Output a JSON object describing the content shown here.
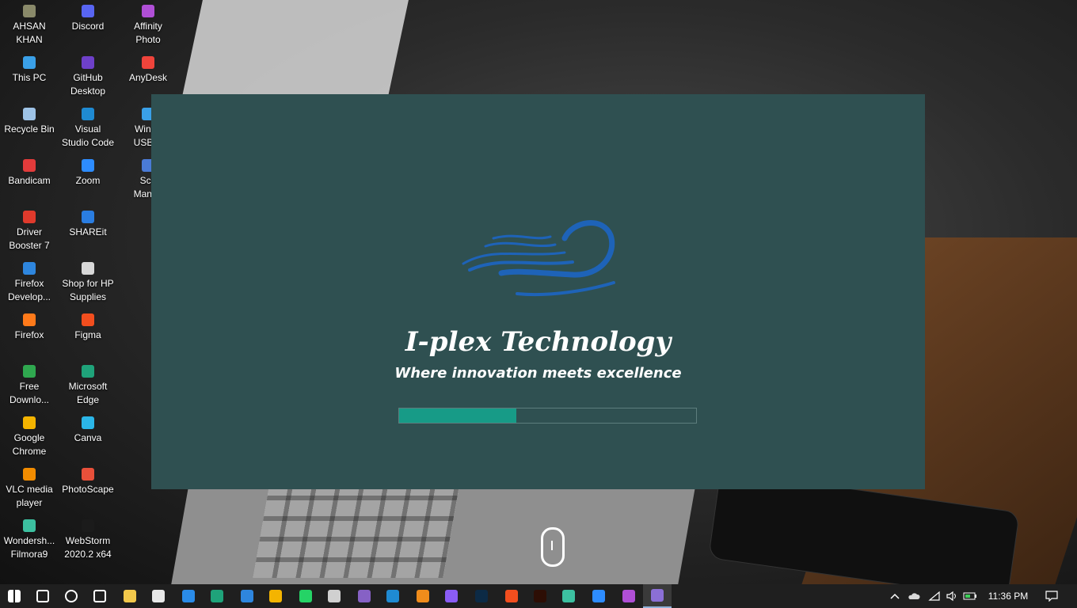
{
  "desktop": {
    "icons": [
      {
        "label": "AHSAN\nKHAN",
        "icon": "user-folder-icon",
        "color": "#8a8a6a"
      },
      {
        "label": "Discord",
        "icon": "discord-icon",
        "color": "#5865f2"
      },
      {
        "label": "Affinity\nPhoto",
        "icon": "affinity-photo-icon",
        "color": "#b04fd6"
      },
      {
        "label": "This PC",
        "icon": "this-pc-icon",
        "color": "#3aa0e8"
      },
      {
        "label": "GitHub\nDesktop",
        "icon": "github-desktop-icon",
        "color": "#6e40c9"
      },
      {
        "label": "AnyDesk",
        "icon": "anydesk-icon",
        "color": "#ef443b"
      },
      {
        "label": "Recycle Bin",
        "icon": "recycle-bin-icon",
        "color": "#9ec3e6"
      },
      {
        "label": "Visual\nStudio Code",
        "icon": "vscode-icon",
        "color": "#1f8ad2"
      },
      {
        "label": "Windo\nUSB D",
        "icon": "windows-usb-icon",
        "color": "#3aa0e8"
      },
      {
        "label": "Bandicam",
        "icon": "bandicam-icon",
        "color": "#e23b3b"
      },
      {
        "label": "Zoom",
        "icon": "zoom-icon",
        "color": "#2d8cff"
      },
      {
        "label": "Sch\nManag",
        "icon": "school-manager-icon",
        "color": "#4a7bd6"
      },
      {
        "label": "Driver\nBooster 7",
        "icon": "driver-booster-icon",
        "color": "#e03a2c"
      },
      {
        "label": "SHAREit",
        "icon": "shareit-icon",
        "color": "#2a7de1"
      },
      {
        "label": "Firefox\nDevelop...",
        "icon": "firefox-developer-icon",
        "color": "#2e86de"
      },
      {
        "label": "Shop for HP\nSupplies",
        "icon": "hp-supplies-icon",
        "color": "#d8d8d8"
      },
      {
        "label": "Firefox",
        "icon": "firefox-icon",
        "color": "#ff7a1a"
      },
      {
        "label": "Figma",
        "icon": "figma-icon",
        "color": "#f24e1e"
      },
      {
        "label": "Free\nDownlo...",
        "icon": "free-download-manager-icon",
        "color": "#2fa84f"
      },
      {
        "label": "Microsoft\nEdge",
        "icon": "edge-icon",
        "color": "#1fa37a"
      },
      {
        "label": "Google\nChrome",
        "icon": "chrome-icon",
        "color": "#f4b400"
      },
      {
        "label": "Canva",
        "icon": "canva-icon",
        "color": "#2bb6e8"
      },
      {
        "label": "VLC media\nplayer",
        "icon": "vlc-icon",
        "color": "#f28c00"
      },
      {
        "label": "PhotoScape",
        "icon": "photoscape-icon",
        "color": "#e8503a"
      },
      {
        "label": "Wondersh...\nFilmora9",
        "icon": "filmora-icon",
        "color": "#3cc0a0"
      },
      {
        "label": "WebStorm\n2020.2 x64",
        "icon": "webstorm-icon",
        "color": "#1b1b1b"
      }
    ]
  },
  "splash": {
    "brand": "I-plex Technology",
    "tagline": "Where innovation meets excellence",
    "progress_fraction": 0.395,
    "colors": {
      "background": "#2f5051",
      "progress": "#179b87",
      "logo": "#1e63b8"
    }
  },
  "taskbar": {
    "apps": [
      {
        "icon": "windows-start-icon",
        "color": "#ffffff"
      },
      {
        "icon": "search-icon",
        "color": "#ffffff"
      },
      {
        "icon": "cortana-icon",
        "color": "#ffffff"
      },
      {
        "icon": "task-view-icon",
        "color": "#ffffff"
      },
      {
        "icon": "file-explorer-icon",
        "color": "#f2c84b"
      },
      {
        "icon": "microsoft-store-icon",
        "color": "#e8e8e8"
      },
      {
        "icon": "mail-icon",
        "color": "#2a8be8"
      },
      {
        "icon": "edge-icon",
        "color": "#1fa37a"
      },
      {
        "icon": "firefox-icon",
        "color": "#2e86de"
      },
      {
        "icon": "chrome-icon",
        "color": "#f4b400"
      },
      {
        "icon": "whatsapp-icon",
        "color": "#25d366"
      },
      {
        "icon": "onedrive-icon",
        "color": "#d0d0d0"
      },
      {
        "icon": "visual-studio-icon",
        "color": "#8661c5"
      },
      {
        "icon": "vscode-icon",
        "color": "#1f8ad2"
      },
      {
        "icon": "sublime-text-icon",
        "color": "#f08c1b"
      },
      {
        "icon": "github-desktop-icon",
        "color": "#8a5cf5"
      },
      {
        "icon": "photoshop-icon",
        "color": "#0c2a45"
      },
      {
        "icon": "figma-icon",
        "color": "#f24e1e"
      },
      {
        "icon": "illustrator-icon",
        "color": "#2d0e05"
      },
      {
        "icon": "filmora-icon",
        "color": "#3cc0a0"
      },
      {
        "icon": "zoom-icon",
        "color": "#2d8cff"
      },
      {
        "icon": "affinity-photo-icon",
        "color": "#b04fd6"
      },
      {
        "icon": "iplex-app-icon",
        "color": "#8b6fd6"
      }
    ],
    "tray": {
      "time": "11:36 PM",
      "icons": [
        "show-hidden-icons-chevron",
        "onedrive-tray-icon",
        "wifi-icon",
        "volume-icon",
        "battery-icon",
        "notifications-icon"
      ]
    }
  }
}
